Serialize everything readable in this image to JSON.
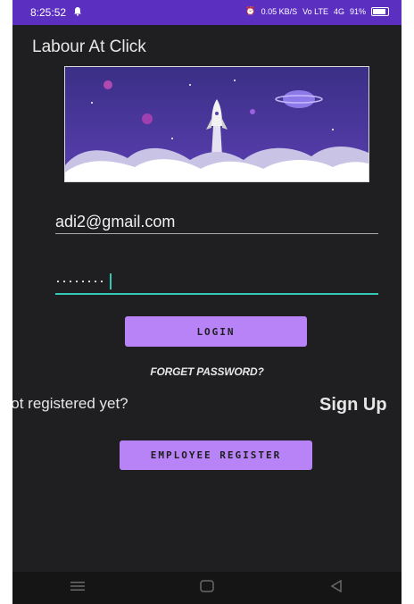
{
  "status": {
    "time": "8:25:52",
    "network_speed": "0.05 KB/S",
    "volte": "Vo LTE",
    "signal": "4G",
    "battery": "91%"
  },
  "app": {
    "title": "Labour At Click"
  },
  "form": {
    "email_value": "adi2@gmail.com",
    "password_masked": "········"
  },
  "buttons": {
    "login": "LOGIN",
    "forget_password": "FORGET PASSWORD?",
    "employee_register": "EMPLOYEE REGISTER"
  },
  "register": {
    "prompt": "Not registered yet?",
    "sign_up": "Sign Up"
  },
  "colors": {
    "status_bar": "#5b2fc0",
    "background": "#1f1f21",
    "button": "#b783f6",
    "accent_line": "#33c7b6"
  },
  "icons": {
    "notification": "bell-icon",
    "nav_menu": "menu-icon",
    "nav_home": "home-icon",
    "nav_back": "back-icon"
  }
}
